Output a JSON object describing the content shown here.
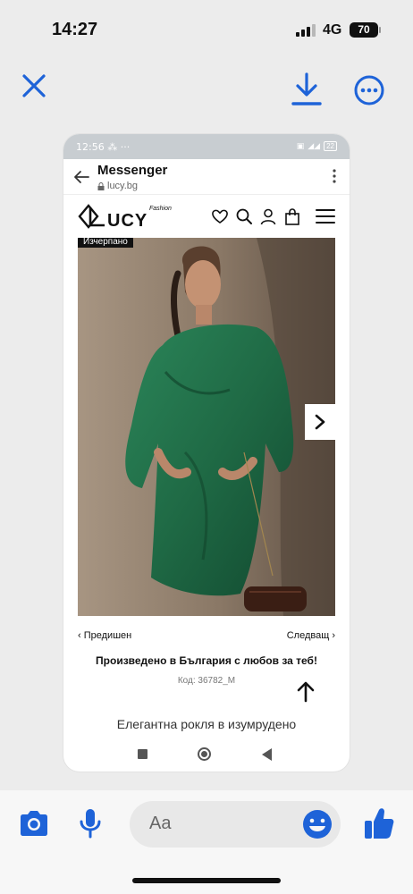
{
  "ios_status": {
    "time": "14:27",
    "network": "4G",
    "battery": "70"
  },
  "viewer": {
    "close_icon": "close-icon",
    "download_icon": "download-icon",
    "more_icon": "more-icon",
    "accent": "#1e63d8"
  },
  "android_status": {
    "time": "12:56",
    "battery": "22"
  },
  "messenger_bar": {
    "title": "Messenger",
    "url": "lucy.bg"
  },
  "site": {
    "logo_text": "UCY",
    "logo_sub": "Fashion",
    "badge": "Изчерпано",
    "icons": [
      "heart-icon",
      "search-icon",
      "user-icon",
      "bag-icon"
    ]
  },
  "product": {
    "prev_label": "Предишен",
    "next_label": "Следващ",
    "made_in": "Произведено в България с любов за теб!",
    "sku": "Код: 36782_M",
    "title": "Елегантна рокля в изумрудено",
    "dress_color": "#1f6a45"
  },
  "composer": {
    "placeholder": "Aa",
    "accent": "#1e63d8"
  }
}
